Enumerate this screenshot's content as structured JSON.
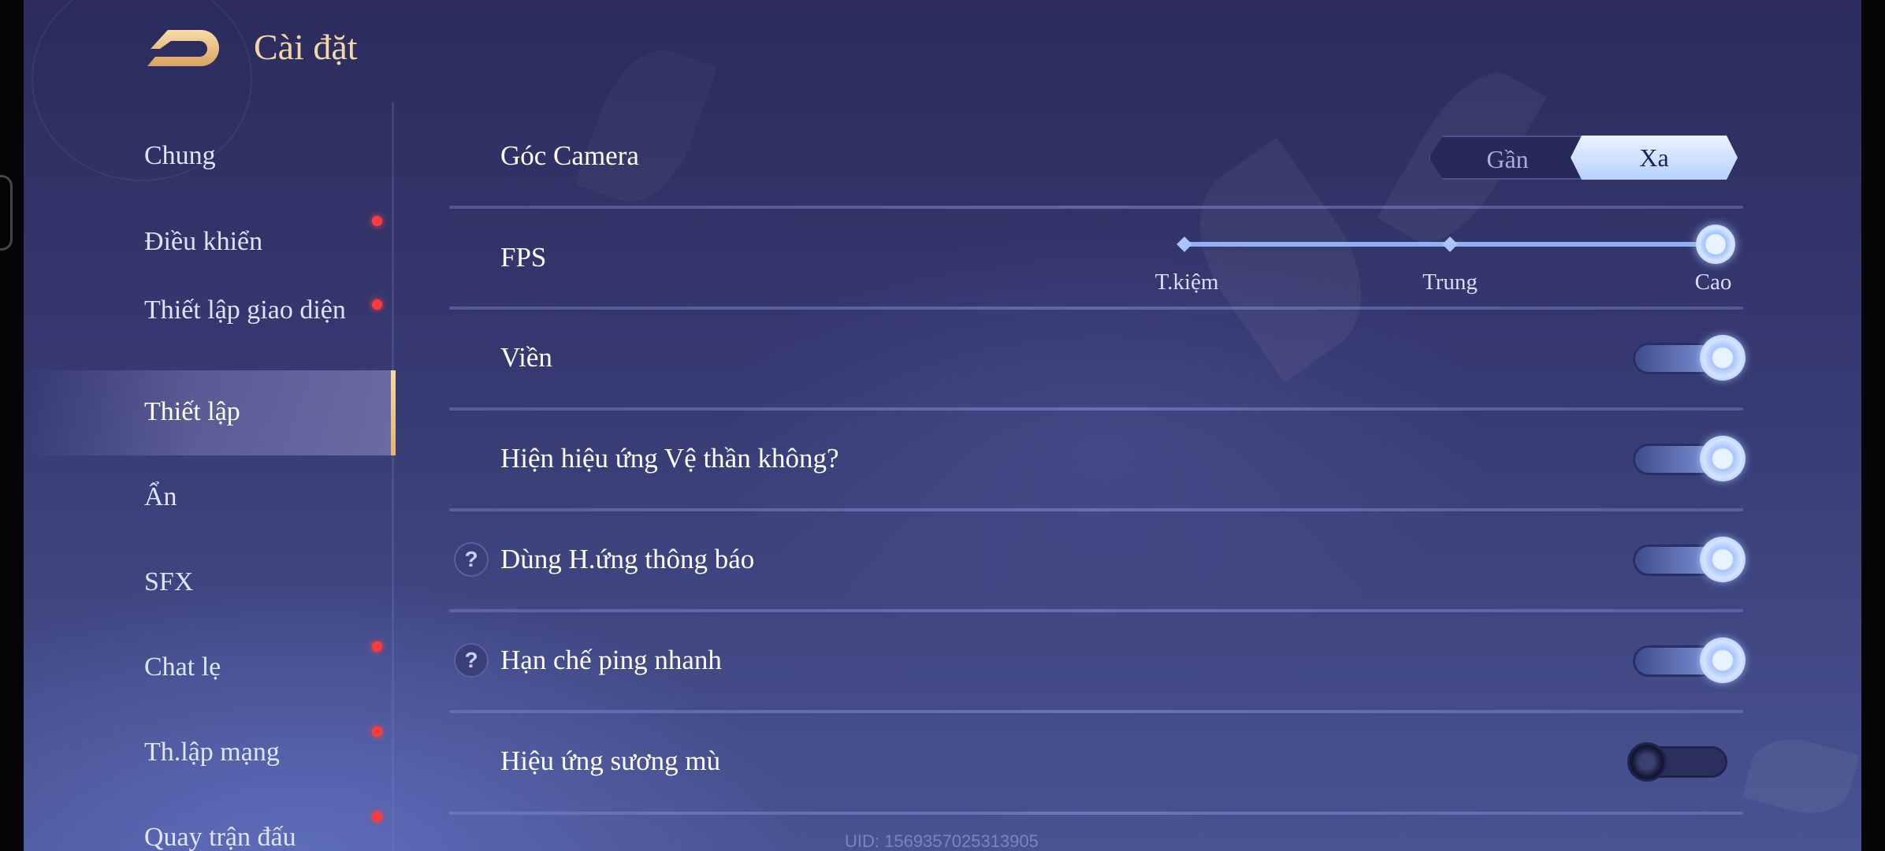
{
  "header": {
    "title": "Cài đặt"
  },
  "sidebar": {
    "items": [
      {
        "label": "Chung",
        "dot": false,
        "active": false
      },
      {
        "label": "Điều khiển",
        "dot": true,
        "active": false
      },
      {
        "label": "Thiết lập giao diện",
        "dot": true,
        "active": false
      },
      {
        "label": "Thiết lập",
        "dot": false,
        "active": true
      },
      {
        "label": "Ẩn",
        "dot": false,
        "active": false
      },
      {
        "label": "SFX",
        "dot": false,
        "active": false
      },
      {
        "label": "Chat lẹ",
        "dot": true,
        "active": false
      },
      {
        "label": "Th.lập mạng",
        "dot": true,
        "active": false
      },
      {
        "label": "Quay trận đấu",
        "dot": true,
        "active": false
      }
    ]
  },
  "settings": {
    "camera": {
      "label": "Góc Camera",
      "options": [
        "Gần",
        "Xa"
      ],
      "selected": "Xa"
    },
    "fps": {
      "label": "FPS",
      "levels": [
        "T.kiệm",
        "Trung",
        "Cao"
      ],
      "selected": "Cao"
    },
    "toggles": [
      {
        "label": "Viền",
        "on": true,
        "help": false
      },
      {
        "label": "Hiện hiệu ứng Vệ thần không?",
        "on": true,
        "help": false
      },
      {
        "label": "Dùng H.ứng thông báo",
        "on": true,
        "help": true
      },
      {
        "label": "Hạn chế ping nhanh",
        "on": true,
        "help": true
      },
      {
        "label": "Hiệu ứng sương mù",
        "on": false,
        "help": false
      }
    ],
    "help_glyph": "?"
  },
  "footer": {
    "uid": "UID: 1569357025313905"
  },
  "colors": {
    "title_gold": "#f1d7a3",
    "dot_red": "#ff3b3b",
    "accent_blue": "#b7d1ff"
  }
}
